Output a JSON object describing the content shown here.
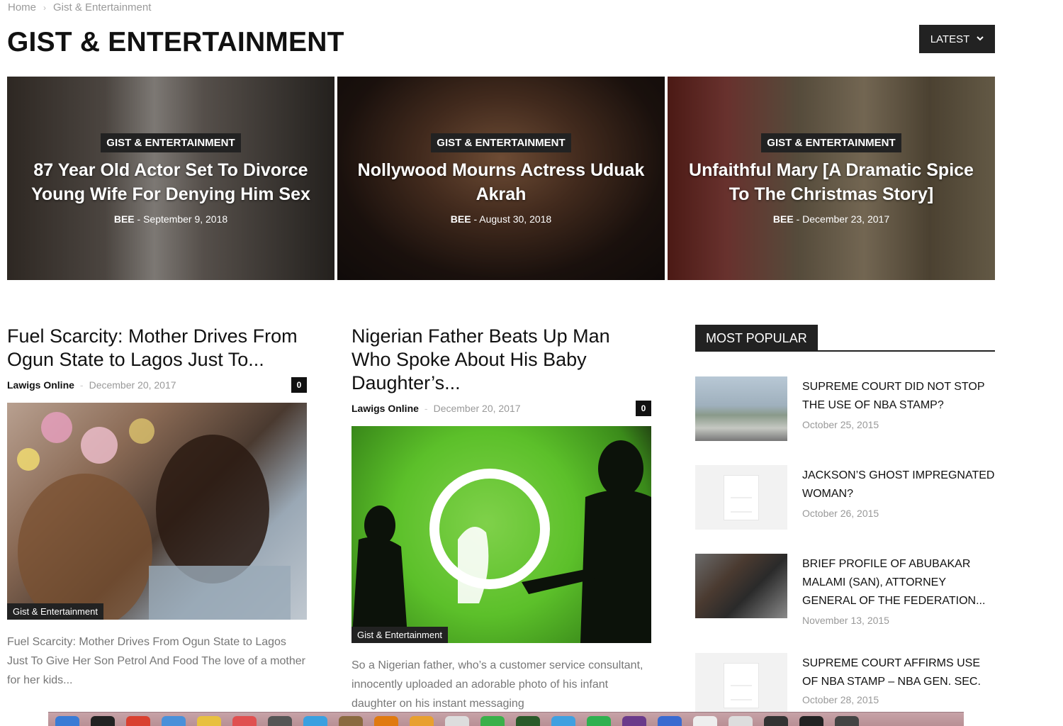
{
  "breadcrumb": {
    "home": "Home",
    "separator": "›",
    "current": "Gist & Entertainment"
  },
  "page_title": "GIST & ENTERTAINMENT",
  "sort_button": {
    "label": "LATEST",
    "icon": "chevron-down-icon"
  },
  "featured": [
    {
      "category": "GIST & ENTERTAINMENT",
      "title": "87 Year Old Actor Set To Divorce Young Wife For Denying Him Sex",
      "author": "BEE",
      "separator": "-",
      "date": "September 9, 2018"
    },
    {
      "category": "GIST & ENTERTAINMENT",
      "title": "Nollywood Mourns Actress Uduak Akrah",
      "author": "BEE",
      "separator": "-",
      "date": "August 30, 2018"
    },
    {
      "category": "GIST & ENTERTAINMENT",
      "title": "Unfaithful Mary [A Dramatic Spice To The Christmas Story]",
      "author": "BEE",
      "separator": "-",
      "date": "December 23, 2017"
    }
  ],
  "articles": [
    {
      "title": "Fuel Scarcity: Mother Drives From Ogun State to Lagos Just To...",
      "author": "Lawigs Online",
      "separator": "-",
      "date": "December 20, 2017",
      "comments": "0",
      "tag": "Gist & Entertainment",
      "excerpt": "Fuel Scarcity: Mother Drives From Ogun State to Lagos Just To Give Her Son Petrol And Food The love of a mother for her kids..."
    },
    {
      "title": "Nigerian Father Beats Up Man Who Spoke About His Baby Daughter’s...",
      "author": "Lawigs Online",
      "separator": "-",
      "date": "December 20, 2017",
      "comments": "0",
      "tag": "Gist & Entertainment",
      "excerpt": "So a Nigerian father, who’s a customer service consultant, innocently uploaded an adorable photo of his infant daughter on his instant messaging"
    }
  ],
  "most_popular": {
    "heading": "MOST POPULAR",
    "items": [
      {
        "title": "SUPREME COURT DID NOT STOP THE USE OF NBA STAMP?",
        "date": "October 25, 2015"
      },
      {
        "title": "JACKSON’s GHOST IMPREGNATED WOMAN?",
        "date": "October 26, 2015"
      },
      {
        "title": "BRIEF PROFILE OF ABUBAKAR MALAMI (SAN), ATTORNEY GENERAL OF THE FEDERATION...",
        "date": "November 13, 2015"
      },
      {
        "title": "SUPREME COURT AFFIRMS USE OF NBA STAMP – NBA Gen. Sec.",
        "date": "October 28, 2015"
      }
    ]
  },
  "dock_colors": [
    "#3a7bd5",
    "#222222",
    "#d94030",
    "#4a90d9",
    "#e8c040",
    "#e05050",
    "#555555",
    "#3aa0e0",
    "#8a6a40",
    "#e07a10",
    "#e8a030",
    "#dddddd",
    "#3ab04a",
    "#2a5a2a",
    "#40a0e0",
    "#30b050",
    "#6a3a8a",
    "#3a6ad0",
    "#eeeeee",
    "#dddddd",
    "#333333",
    "#222222",
    "#444444"
  ]
}
